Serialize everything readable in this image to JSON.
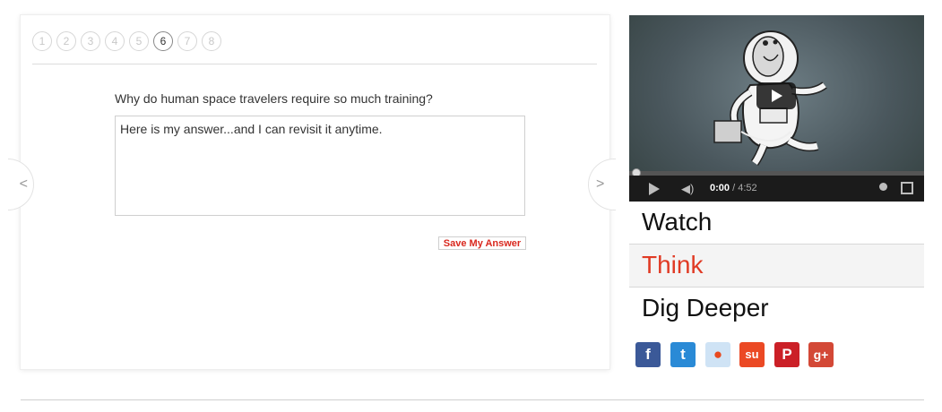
{
  "quiz": {
    "steps": [
      {
        "label": "1",
        "current": false
      },
      {
        "label": "2",
        "current": false
      },
      {
        "label": "3",
        "current": false
      },
      {
        "label": "4",
        "current": false
      },
      {
        "label": "5",
        "current": false
      },
      {
        "label": "6",
        "current": true
      },
      {
        "label": "7",
        "current": false
      },
      {
        "label": "8",
        "current": false
      }
    ],
    "question": "Why do human space travelers require so much training?",
    "answer_value": "Here is my answer...and I can revisit it anytime.",
    "save_label": "Save My Answer",
    "prev_arrow": "<",
    "next_arrow": ">"
  },
  "video": {
    "current_time": "0:00",
    "duration": "4:52",
    "progress": 0.0
  },
  "tabs": [
    {
      "label": "Watch",
      "active": false
    },
    {
      "label": "Think",
      "active": true
    },
    {
      "label": "Dig Deeper",
      "active": false
    }
  ],
  "social": [
    {
      "icon": "facebook-icon",
      "glyph": "f",
      "color": "#3b5998"
    },
    {
      "icon": "twitter-icon",
      "glyph": "t",
      "color": "#2a8ad6"
    },
    {
      "icon": "reddit-icon",
      "glyph": "r",
      "color": "#cfe3f5"
    },
    {
      "icon": "stumbleupon-icon",
      "glyph": "su",
      "color": "#eb4924"
    },
    {
      "icon": "pinterest-icon",
      "glyph": "P",
      "color": "#cb2027"
    },
    {
      "icon": "google-plus-icon",
      "glyph": "g+",
      "color": "#d34836"
    }
  ]
}
